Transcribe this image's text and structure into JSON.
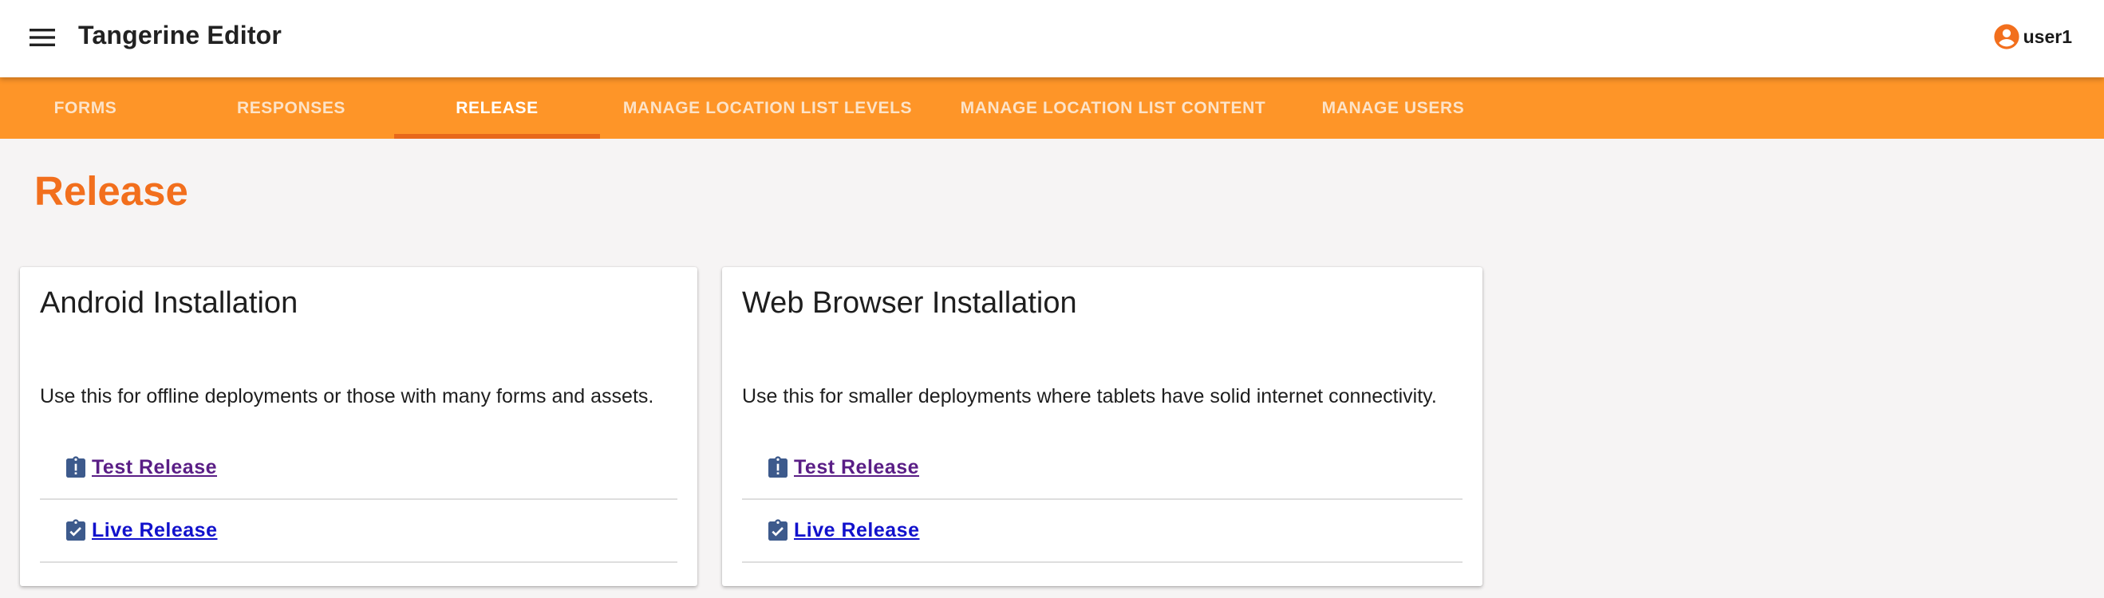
{
  "header": {
    "app_title": "Tangerine Editor",
    "username": "user1",
    "icons": {
      "menu": "menu-icon",
      "user": "account-circle-icon"
    },
    "user_icon_color": "#f26f1d"
  },
  "tabs": [
    {
      "label": "FORMS",
      "active": false
    },
    {
      "label": "RESPONSES",
      "active": false
    },
    {
      "label": "RELEASE",
      "active": true
    },
    {
      "label": "MANAGE LOCATION LIST LEVELS",
      "active": false
    },
    {
      "label": "MANAGE LOCATION LIST CONTENT",
      "active": false
    },
    {
      "label": "MANAGE USERS",
      "active": false
    }
  ],
  "page": {
    "title": "Release"
  },
  "cards": [
    {
      "title": "Android Installation",
      "description": "Use this for offline deployments or those with many forms and assets.",
      "links": [
        {
          "label": " Test Release",
          "icon": "clipboard-alert-icon"
        },
        {
          "label": " Live Release",
          "icon": "clipboard-check-icon"
        }
      ]
    },
    {
      "title": "Web Browser Installation",
      "description": "Use this for smaller deployments where tablets have solid internet connectivity.",
      "links": [
        {
          "label": " Test Release",
          "icon": "clipboard-alert-icon"
        },
        {
          "label": " Live Release",
          "icon": "clipboard-check-icon"
        }
      ]
    }
  ],
  "colors": {
    "tab_bar": "#fe9528",
    "tab_indicator": "#e8681a",
    "page_title": "#f26f1d",
    "icon": "#3d5a8c"
  }
}
